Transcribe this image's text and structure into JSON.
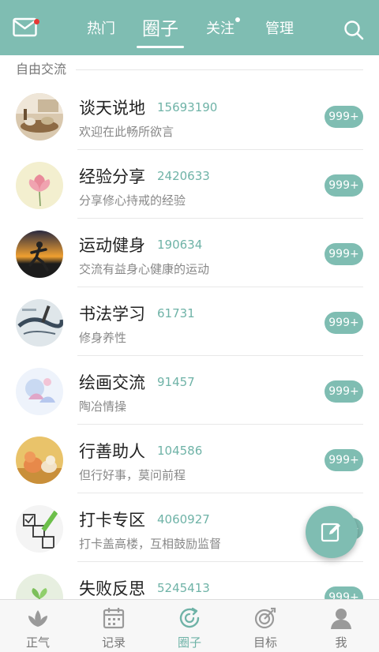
{
  "header": {
    "tabs": [
      {
        "label": "热门"
      },
      {
        "label": "圈子"
      },
      {
        "label": "关注"
      },
      {
        "label": "管理"
      }
    ],
    "active_tab": "圈子"
  },
  "section": {
    "label": "自由交流"
  },
  "circles": [
    {
      "title": "谈天说地",
      "count": "15693190",
      "desc": "欢迎在此畅所欲言",
      "badge": "999+"
    },
    {
      "title": "经验分享",
      "count": "2420633",
      "desc": "分享修心持戒的经验",
      "badge": "999+"
    },
    {
      "title": "运动健身",
      "count": "190634",
      "desc": "交流有益身心健康的运动",
      "badge": "999+"
    },
    {
      "title": "书法学习",
      "count": "61731",
      "desc": "修身养性",
      "badge": "999+"
    },
    {
      "title": "绘画交流",
      "count": "91457",
      "desc": "陶冶情操",
      "badge": "999+"
    },
    {
      "title": "行善助人",
      "count": "104586",
      "desc": "但行好事，莫问前程",
      "badge": "999+"
    },
    {
      "title": "打卡专区",
      "count": "4060927",
      "desc": "打卡盖高楼，互相鼓励监督",
      "badge": "999+"
    },
    {
      "title": "失败反思",
      "count": "5245413",
      "desc": "",
      "badge": "999+"
    }
  ],
  "bottom_nav": [
    {
      "label": "正气",
      "icon": "lotus-icon"
    },
    {
      "label": "记录",
      "icon": "calendar-icon"
    },
    {
      "label": "圈子",
      "icon": "circle-refresh-icon"
    },
    {
      "label": "目标",
      "icon": "target-icon"
    },
    {
      "label": "我",
      "icon": "person-icon"
    }
  ],
  "colors": {
    "accent": "#7fbdb2",
    "badge": "#7fbdb2",
    "count_text": "#6fb3a7"
  }
}
